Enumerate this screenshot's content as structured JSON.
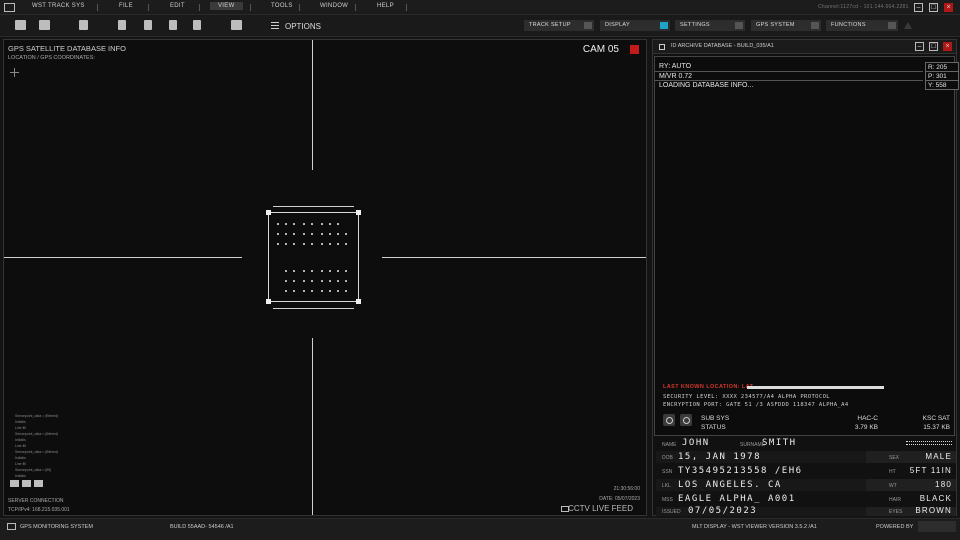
{
  "menubar": {
    "app": "WST TRACK SYS",
    "items": [
      "FILE",
      "EDIT",
      "VIEW",
      "TOOLS",
      "WINDOW",
      "HELP"
    ],
    "active": "VIEW",
    "right_text": "Channel:1127cd - 101.144.664.2281"
  },
  "toolbar": {
    "options_label": "OPTIONS",
    "dropdowns": [
      "TRACK SETUP",
      "DISPLAY",
      "SETTINGS",
      "GPS SYSTEM",
      "FUNCTIONS"
    ]
  },
  "feed": {
    "title": "GPS SATELLITE DATABASE INFO",
    "subtitle": "LOCATION / GPS COORDINATES:",
    "cam": "CAM 05",
    "log_lines": [
      "Sensepoint_data = (filtered)",
      "Initialis",
      "Line fill",
      "Sensepoint_data = (filtered)",
      "Initialis",
      "Line fill",
      "Sensepoint_data = (filtered)",
      "Initialis",
      "Line fill",
      "Sensepoint_data = (filt)",
      "Initialis"
    ],
    "server_label": "SERVER CONNECTION",
    "server_ip": "TCP/IPv4: 168.215.035.001",
    "time": "21:30:56:00",
    "date": "DATE: 05/07/2023",
    "cctv": "CCTV LIVE FEED"
  },
  "id_panel": {
    "title": "ID ARCHIVE DATABASE - BUILD_035/A1",
    "line1": "RY: AUTO",
    "line2": "M/VR 0.72",
    "line3": "LOADING DATABASE INFO...",
    "r_val": "R: 205",
    "p_val": "P: 301",
    "y_val": "Y: 558",
    "alert": "LAST KNOWN LOCATION: LAT",
    "security": "SECURITY LEVEL: XXXX 234577/A4 ALPHA PROTOCOL",
    "encryption": "ENCRYPTION PORT: GATE 51 /3 ASFDDD 118347 ALPHA_A4",
    "sub_sys": "SUB SYS",
    "status": "STATUS",
    "hac": "HAC-C",
    "hac_size": "3.79 KB",
    "ksc": "KSC SAT",
    "ksc_size": "15.37 KB"
  },
  "person": {
    "name_lbl": "NAME",
    "name": "JOHN",
    "surname_lbl": "SURNAME",
    "surname": "SMITH",
    "dob_lbl": "DOB",
    "dob": "15, JAN 1978",
    "ssn_lbl": "SSN",
    "ssn": "TY35495213558 /EH6",
    "lkl_lbl": "LKL",
    "lkl": "LOS ANGELES. CA",
    "mss_lbl": "MSS",
    "mss": "EAGLE ALPHA_ A001",
    "issued_lbl": "ISSUED",
    "issued": "07/05/2023",
    "sex_lbl": "SEX",
    "sex": "MALE",
    "ht_lbl": "HT",
    "ht": "5FT 11IN",
    "wt_lbl": "WT",
    "wt": "180",
    "hair_lbl": "HAIR",
    "hair": "BLACK",
    "eyes_lbl": "EYES",
    "eyes": "BROWN"
  },
  "statusbar": {
    "left": "GPS MONITORING SYSTEM",
    "build": "BUILD 55AAD- 54546 /A1",
    "viewer": "MLT DISPLAY - WST VIEWER VERSION 3.5.2 /A1",
    "powered": "POWERED BY"
  }
}
